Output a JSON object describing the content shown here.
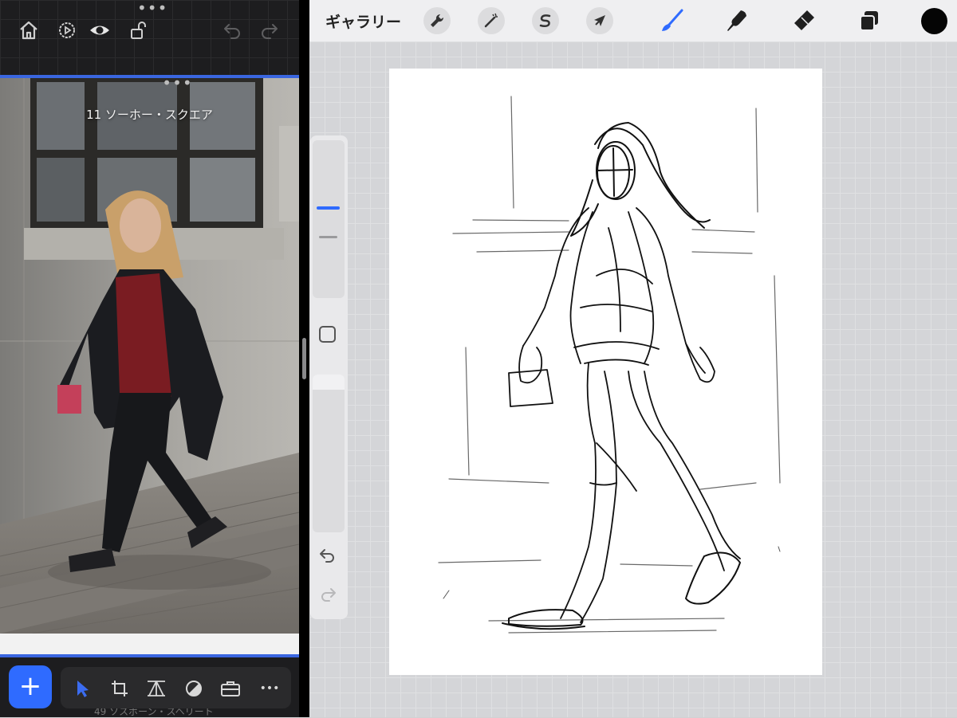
{
  "left_app": {
    "photo_caption": "11 ソーホー・スクエア",
    "bottom_caption": "49 ソスボーン・スヘリート",
    "add_label": "+",
    "more_label": "•••"
  },
  "procreate": {
    "gallery_label": "ギャラリー",
    "color": "#050505",
    "accent": "#2f6bff"
  },
  "icons": {
    "left_toolbar": [
      "home-icon",
      "settings-play-icon",
      "eye-icon",
      "unlock-icon",
      "undo-icon",
      "redo-icon"
    ],
    "left_bottom": [
      "select-arrow-icon",
      "crop-icon",
      "perspective-icon",
      "contrast-icon",
      "briefcase-icon",
      "more-icon"
    ],
    "procreate_top": [
      "wrench-icon",
      "magic-wand-icon",
      "s-curve-icon",
      "arrow-cursor-icon",
      "brush-icon",
      "smudge-icon",
      "eraser-icon",
      "layers-icon"
    ]
  }
}
